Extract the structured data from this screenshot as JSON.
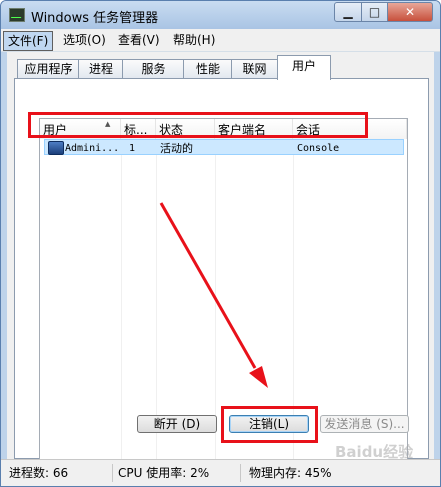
{
  "window": {
    "title": "Windows 任务管理器"
  },
  "menu": [
    "文件(F)",
    "选项(O)",
    "查看(V)",
    "帮助(H)"
  ],
  "tabs": [
    "应用程序",
    "进程",
    "服务",
    "性能",
    "联网",
    "用户"
  ],
  "columns": [
    "用户",
    "标...",
    "状态",
    "客户端名",
    "会话"
  ],
  "rows": [
    {
      "user": "Admini...",
      "id": "1",
      "status": "活动的",
      "client": "",
      "session": "Console"
    }
  ],
  "buttons": {
    "disconnect": "断开 (D)",
    "logoff": "注销(L)",
    "send_message": "发送消息 (S)..."
  },
  "status": {
    "processes": "进程数: 66",
    "cpu": "CPU 使用率: 2%",
    "memory": "物理内存: 45%"
  },
  "watermark": "Baidu经验",
  "colors": {
    "highlight": "#e8111a",
    "arrow": "#e8111a",
    "selection": "#cce8ff"
  }
}
